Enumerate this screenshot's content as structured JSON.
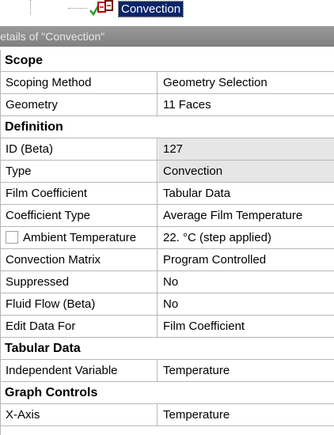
{
  "tree": {
    "selected_item": "Convection",
    "icon": "convection-icon"
  },
  "details": {
    "header_title": "Details of \"Convection\""
  },
  "grid": {
    "sections": [
      {
        "title": "Scope",
        "rows": [
          {
            "name": "Scoping Method",
            "value": "Geometry Selection"
          },
          {
            "name": "Geometry",
            "value": "11 Faces"
          }
        ]
      },
      {
        "title": "Definition",
        "rows": [
          {
            "name": "ID (Beta)",
            "value": "127"
          },
          {
            "name": "Type",
            "value": "Convection"
          },
          {
            "name": "Film Coefficient",
            "value": "Tabular Data"
          },
          {
            "name": "Coefficient Type",
            "value": "Average Film Temperature"
          },
          {
            "name": "Ambient Temperature",
            "value": "22. °C  (step applied)"
          },
          {
            "name": "Convection Matrix",
            "value": "Program Controlled"
          },
          {
            "name": "Suppressed",
            "value": "No"
          },
          {
            "name": "Fluid Flow (Beta)",
            "value": "No"
          },
          {
            "name": "Edit Data For",
            "value": "Film Coefficient"
          }
        ]
      },
      {
        "title": "Tabular Data",
        "rows": [
          {
            "name": "Independent Variable",
            "value": "Temperature"
          }
        ]
      },
      {
        "title": "Graph Controls",
        "rows": [
          {
            "name": "X-Axis",
            "value": "Temperature"
          }
        ]
      }
    ]
  },
  "colors": {
    "selection": "#0a246a",
    "header_bar": "#8c8c8c",
    "readonly_cell": "#e6e6e6",
    "grid_line": "#b7b7b7"
  }
}
